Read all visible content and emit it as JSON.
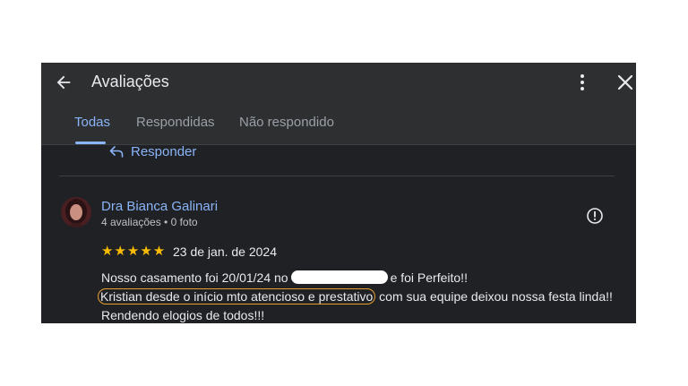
{
  "header": {
    "title": "Avaliações",
    "tabs": [
      {
        "label": "Todas",
        "active": true
      },
      {
        "label": "Respondidas",
        "active": false
      },
      {
        "label": "Não respondido",
        "active": false
      }
    ]
  },
  "reply_action": {
    "label": "Responder"
  },
  "review": {
    "author": "Dra Bianca Galinari",
    "meta": "4 avaliações • 0 foto",
    "rating": 5,
    "stars_text": "★★★★★",
    "date": "23 de jan. de 2024",
    "text_part1": "Nosso casamento foi 20/01/24 no",
    "text_part2": "e foi Perfeito!!",
    "text_highlight": "Kristian desde o início mto atencioso e prestativo",
    "text_part3": "com sua equipe deixou nossa festa linda!! Rendendo elogios de todos!!!"
  },
  "colors": {
    "accent": "#8ab4f8",
    "star": "#fbbc04",
    "highlight_outline": "#e6a032"
  },
  "icons": [
    "arrow-back-icon",
    "more-vert-icon",
    "close-icon",
    "reply-icon",
    "report-icon"
  ]
}
